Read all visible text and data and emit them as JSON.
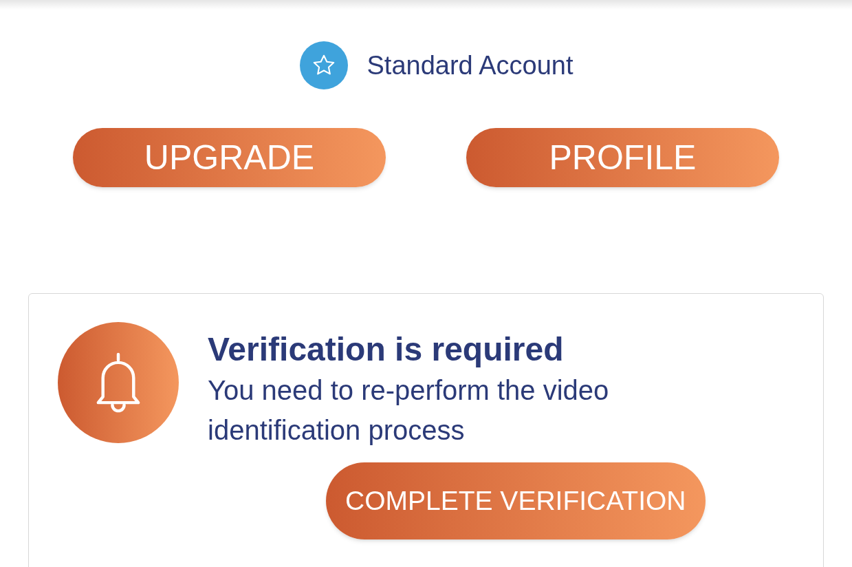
{
  "account": {
    "label": "Standard Account"
  },
  "actions": [
    "UPGRADE",
    "PROFILE"
  ],
  "notice": {
    "title": "Verification is required",
    "message": "You need to re-perform the video identification process",
    "button": "COMPLETE VERIFICATION"
  }
}
